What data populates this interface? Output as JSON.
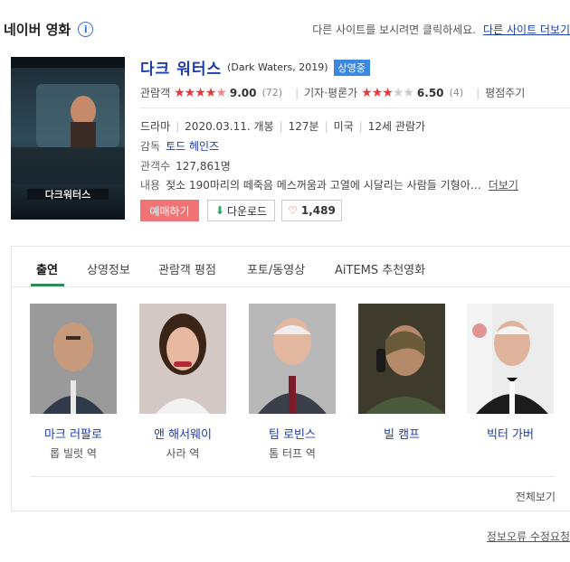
{
  "header": {
    "title": "네이버 영화",
    "info_icon": "i",
    "notice": "다른 사이트를 보시려면 클릭하세요.",
    "more_link": "다른 사이트 더보기"
  },
  "movie": {
    "title_kr": "다크 워터스",
    "title_en": "(Dark Waters, 2019)",
    "badge": "상영중",
    "poster_title": "다크워터스",
    "audience_label": "관람객",
    "audience_score": "9.00",
    "audience_count": "(72)",
    "critic_label": "기자·평론가",
    "critic_score": "6.50",
    "critic_count": "(4)",
    "review_link": "평점주기",
    "genre": "드라마",
    "release": "2020.03.11. 개봉",
    "runtime": "127분",
    "country": "미국",
    "age": "12세 관람가",
    "director_label": "감독",
    "director": "토드 헤인즈",
    "attendance_label": "관객수",
    "attendance": "127,861명",
    "synopsis_label": "내용",
    "synopsis": "젖소 190마리의 떼죽음 메스꺼움과 고열에 시달리는 사람들 기형아…",
    "synopsis_more": "더보기"
  },
  "actions": {
    "book": "예매하기",
    "download": "다운로드",
    "like_count": "1,489"
  },
  "tabs": [
    "출연",
    "상영정보",
    "관람객 평점",
    "포토/동영상",
    "AiTEMS 추천영화"
  ],
  "cast": [
    {
      "name": "마크 러팔로",
      "role": "롭 빌럿 역"
    },
    {
      "name": "앤 해서웨이",
      "role": "사라 역"
    },
    {
      "name": "팀 로빈스",
      "role": "톰 터프 역"
    },
    {
      "name": "빌 캠프",
      "role": ""
    },
    {
      "name": "빅터 가버",
      "role": ""
    }
  ],
  "see_all": "전체보기",
  "report_link": "정보오류 수정요청",
  "colors": {
    "link": "#1f3bb0",
    "badge": "#3c87e0",
    "star": "#e6383f",
    "book_btn": "#f07476",
    "tab_active": "#2e8b57"
  }
}
